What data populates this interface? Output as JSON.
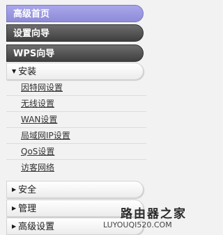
{
  "menu": {
    "home": "高级首页",
    "setup_wizard": "设置向导",
    "wps_wizard": "WPS向导",
    "install": {
      "label": "安装",
      "expanded_icon": "triangle-down-icon",
      "items": [
        "因特网设置",
        "无线设置",
        "WAN设置",
        "局域网IP设置",
        "QoS设置",
        "访客网络"
      ]
    },
    "security": {
      "label": "安全",
      "collapsed_icon": "triangle-right-icon"
    },
    "manage": {
      "label": "管理",
      "collapsed_icon": "triangle-right-icon"
    },
    "advanced": {
      "label": "高级设置",
      "collapsed_icon": "triangle-right-icon"
    }
  },
  "watermark": {
    "title": "路由器之家",
    "url": "LUYOUQI520.COM"
  }
}
